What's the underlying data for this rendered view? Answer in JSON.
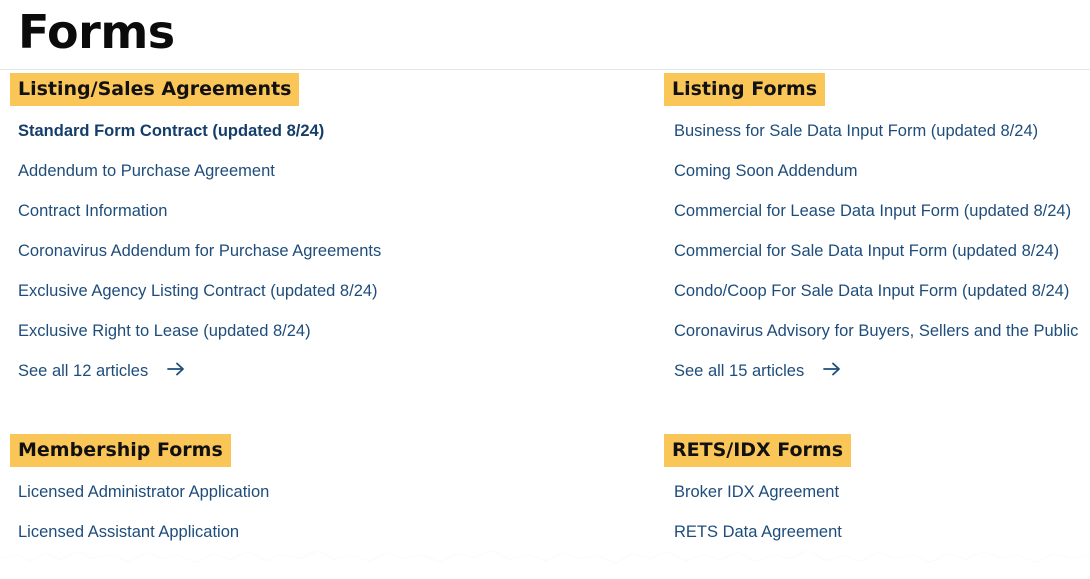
{
  "page": {
    "title": "Forms"
  },
  "sections": [
    {
      "heading": "Listing/Sales Agreements",
      "links": [
        "Standard Form Contract (updated 8/24)",
        "Addendum to Purchase Agreement",
        "Contract Information",
        "Coronavirus Addendum for Purchase Agreements",
        "Exclusive Agency Listing Contract (updated 8/24)",
        "Exclusive Right to Lease (updated 8/24)"
      ],
      "see_all": "See all 12 articles"
    },
    {
      "heading": "Listing Forms",
      "links": [
        "Business for Sale Data Input Form (updated 8/24)",
        "Coming Soon Addendum",
        "Commercial for Lease Data Input Form (updated 8/24)",
        "Commercial for Sale Data Input Form (updated 8/24)",
        "Condo/Coop For Sale Data Input Form (updated 8/24)",
        "Coronavirus Advisory for Buyers, Sellers and the Public"
      ],
      "see_all": "See all 15 articles"
    },
    {
      "heading": "Membership Forms",
      "links": [
        "Licensed Administrator Application",
        "Licensed Assistant Application"
      ]
    },
    {
      "heading": "RETS/IDX Forms",
      "links": [
        "Broker IDX Agreement",
        "RETS Data Agreement"
      ]
    }
  ],
  "colors": {
    "heading_highlight": "#fbc658",
    "link": "#1e4d7b",
    "title": "#0b0b0b"
  },
  "icons": {
    "see_all": "arrow-right-icon"
  }
}
